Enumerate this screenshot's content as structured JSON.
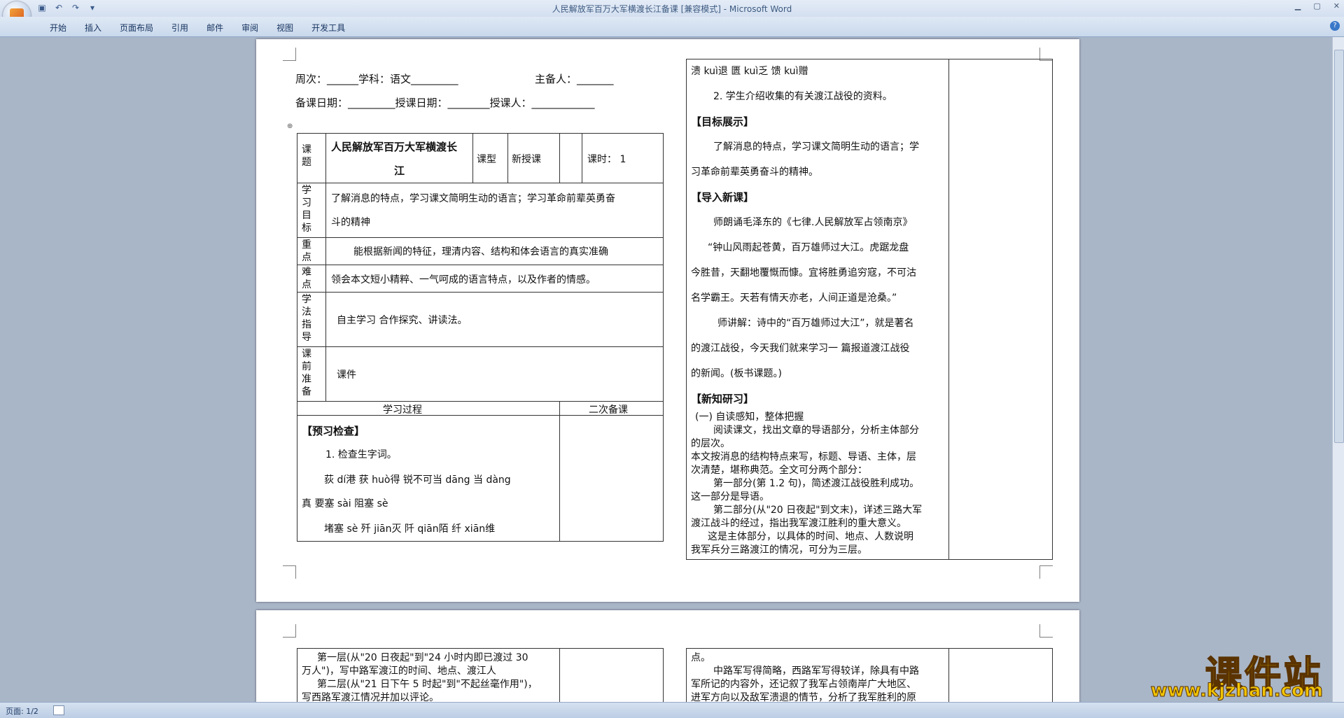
{
  "window": {
    "title": "人民解放军百万大军横渡长江备课 [兼容模式] - Microsoft Word"
  },
  "qat": [
    "save-icon",
    "undo-icon",
    "redo-icon",
    "dropdown-icon"
  ],
  "ribbon": {
    "tabs": [
      "开始",
      "插入",
      "页面布局",
      "引用",
      "邮件",
      "审阅",
      "视图",
      "开发工具"
    ]
  },
  "status": {
    "page": "页面: 1/2"
  },
  "doc": {
    "header1": "周次：______学科：语文_________",
    "header1b": "主备人：_______",
    "header2": "备课日期：_________授课日期：________授课人：____________",
    "left_table": {
      "r1_label": "课题",
      "title1": "人民解放军百万大军横渡长",
      "title2": "江",
      "type_label": "课型",
      "type_value": "新授课",
      "hours": "课时：  1",
      "goal_label": "学习目标",
      "goal1": "了解消息的特点，学习课文简明生动的语言；学习革命前辈英勇奋",
      "goal2": "斗的精神",
      "key_label": "重点",
      "key_text": "能根据新闻的特征，理清内容、结构和体会语言的真实准确",
      "diff_label": "难点",
      "diff_text": "领会本文短小精粹、一气呵成的语言特点，以及作者的情感。",
      "method_label": "学法指导",
      "method_text": "自主学习    合作探究、讲读法。",
      "prep_label": "课前准备",
      "prep_text": "课件",
      "process": "学习过程",
      "second": "二次备课",
      "preview_head": "【预习检查】",
      "p1": "1. 检查生字词。",
      "p2": "荻 dí港   获 huò得   锐不可当 dāng   当 dàng",
      "p3": "真   要塞 sài 阻塞 sè",
      "p4": "堵塞 sè   歼 jiān灭     阡 qiān陌   纤 xiān维"
    },
    "right_col": {
      "l1": "溃 kuì退    匮 kuì乏      馈 kuì赠",
      "l2": "2. 学生介绍收集的有关渡江战役的资料。",
      "h1": "【目标展示】",
      "g1": "了解消息的特点，学习课文简明生动的语言；学",
      "g2": "习革命前辈英勇奋斗的精神。",
      "h2": "【导入新课】",
      "i1": "师朗诵毛泽东的《七律.人民解放军占领南京》",
      "i2": "“钟山风雨起苍黄，百万雄师过大江。虎踞龙盘",
      "i3": "今胜昔，天翻地覆慨而慷。宜将胜勇追穷寇，不可沽",
      "i4": "名学霸王。天若有情天亦老，人间正道是沧桑。”",
      "i5": "师讲解：诗中的“百万雄师过大江”，就是著名",
      "i6": "的渡江战役，今天我们就来学习一 篇报道渡江战役",
      "i7": "的新闻。(板书课题。)",
      "h3": "【新知研习】",
      "n1": "(一) 自读感知，整体把握",
      "n2": "阅读课文，找出文章的导语部分，分析主体部分",
      "n3": "的层次。",
      "n4": "本文按消息的结构特点来写，标题、导语、主体，层",
      "n5": "次清楚，堪称典范。全文可分两个部分：",
      "n6": "第一部分(第 1.2 句)，简述渡江战役胜利成功。",
      "n7": "这一部分是导语。",
      "n8": "第二部分(从\"20 日夜起\"到文末)，详述三路大军",
      "n9": "渡江战斗的经过，指出我军渡江胜利的重大意义。",
      "n10": "这是主体部分，以具体的时间、地点、人数说明",
      "n11": "我军兵分三路渡江的情况，可分为三层。"
    },
    "page2": {
      "a1": "第一层(从\"20 日夜起\"到\"24 小时内即已渡过 30",
      "a2": "万人\")，写中路军渡江的时间、地点、渡江人",
      "a3": "第二层(从\"21 日下午 5 时起\"到\"不起丝毫作用\")，",
      "a4": "写西路军渡江情况并加以评论。",
      "b1": "点。",
      "b2": "中路军写得简略，西路军写得较详，除具有中路",
      "b3": "军所记的内容外，还记叙了我军占领南岸广大地区、",
      "b4": "进军方向以及敌军溃退的情节，分析了我军胜利的原"
    }
  },
  "watermark": {
    "text": "课件站",
    "url": "www.kjzhan.com"
  }
}
